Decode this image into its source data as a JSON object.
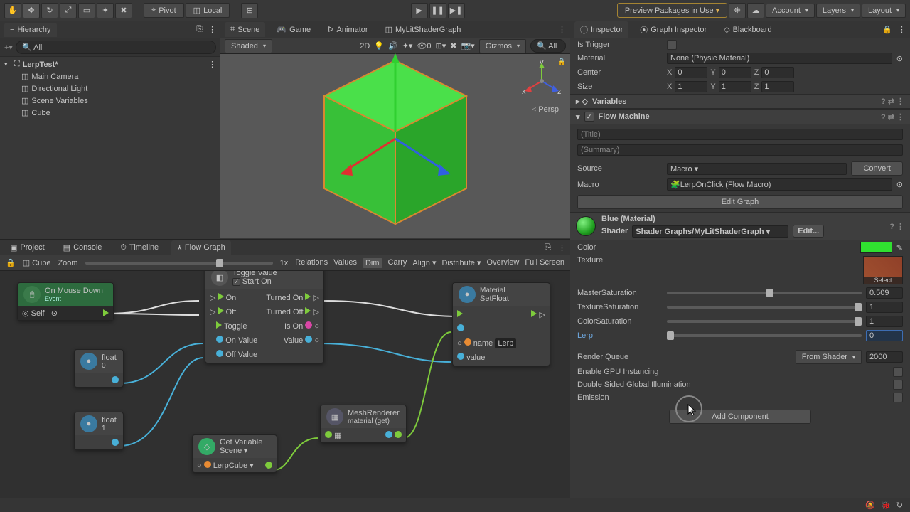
{
  "toolbar": {
    "pivot": "Pivot",
    "local": "Local",
    "preview": "Preview Packages in Use",
    "account": "Account",
    "layers": "Layers",
    "layout": "Layout"
  },
  "hierarchy": {
    "tab": "Hierarchy",
    "search": "All",
    "scene": "LerpTest*",
    "items": [
      "Main Camera",
      "Directional Light",
      "Scene Variables",
      "Cube"
    ]
  },
  "sceneTabs": {
    "scene": "Scene",
    "game": "Game",
    "animator": "Animator",
    "shader": "MyLitShaderGraph"
  },
  "sceneBar": {
    "shading": "Shaded",
    "mode": "2D",
    "gizmos": "Gizmos",
    "search": "All",
    "persp": "Persp"
  },
  "bottom": {
    "tabs": {
      "project": "Project",
      "console": "Console",
      "timeline": "Timeline",
      "flow": "Flow Graph"
    },
    "crumb": "Cube",
    "zoom": "Zoom",
    "zoomVal": "1x",
    "opts": {
      "relations": "Relations",
      "values": "Values",
      "dim": "Dim",
      "carry": "Carry",
      "align": "Align",
      "distribute": "Distribute",
      "overview": "Overview",
      "full": "Full Screen"
    }
  },
  "nodes": {
    "mouseDown": {
      "title": "On Mouse Down",
      "sub": "Event",
      "self": "Self"
    },
    "float0": {
      "title": "float",
      "val": "0"
    },
    "float1": {
      "title": "float",
      "val": "1"
    },
    "toggle": {
      "title": "Toggle Value",
      "startOn": "Start On",
      "on": "On",
      "off": "Off",
      "toggle": "Toggle",
      "onVal": "On Value",
      "offVal": "Off Value",
      "turnedOn": "Turned On",
      "turnedOff": "Turned Off",
      "isOn": "Is On",
      "value": "Value"
    },
    "getVar": {
      "title": "Get Variable",
      "scope": "Scene",
      "name": "LerpCube"
    },
    "mesh": {
      "title": "MeshRenderer",
      "sub": "material (get)"
    },
    "setFloat": {
      "title": "Material",
      "sub": "SetFloat",
      "name": "name",
      "nameVal": "Lerp",
      "value": "value"
    }
  },
  "inspector": {
    "tabs": {
      "inspector": "Inspector",
      "graph": "Graph Inspector",
      "blackboard": "Blackboard"
    },
    "isTrigger": "Is Trigger",
    "material": "Material",
    "materialVal": "None (Physic Material)",
    "center": "Center",
    "size": "Size",
    "cx": "0",
    "cy": "0",
    "cz": "0",
    "sx": "1",
    "sy": "1",
    "sz": "1",
    "variables": "Variables",
    "flowMachine": "Flow Machine",
    "title": "(Title)",
    "summary": "(Summary)",
    "source": "Source",
    "sourceVal": "Macro",
    "convert": "Convert",
    "macro": "Macro",
    "macroVal": "LerpOnClick (Flow Macro)",
    "editGraph": "Edit Graph",
    "matName": "Blue (Material)",
    "shader": "Shader",
    "shaderVal": "Shader Graphs/MyLitShaderGraph",
    "edit": "Edit...",
    "color": "Color",
    "texture": "Texture",
    "select": "Select",
    "masterSat": "MasterSaturation",
    "masterSatVal": "0.509",
    "texSat": "TextureSaturation",
    "texSatVal": "1",
    "colorSat": "ColorSaturation",
    "colorSatVal": "1",
    "lerp": "Lerp",
    "lerpVal": "0",
    "renderQ": "Render Queue",
    "renderQDrop": "From Shader",
    "renderQVal": "2000",
    "gpu": "Enable GPU Instancing",
    "dsgi": "Double Sided Global Illumination",
    "emission": "Emission",
    "addComp": "Add Component"
  }
}
